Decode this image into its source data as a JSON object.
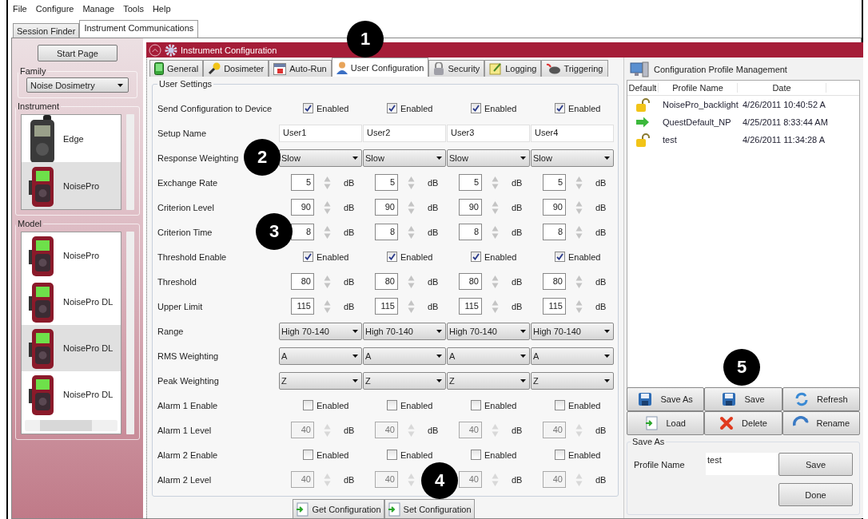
{
  "menu": [
    "File",
    "Configure",
    "Manage",
    "Tools",
    "Help"
  ],
  "tabs": [
    {
      "label": "Session Finder",
      "selected": false
    },
    {
      "label": "Instrument Communications",
      "selected": true
    }
  ],
  "sidebar": {
    "start_button": "Start Page",
    "family": {
      "label": "Family",
      "value": "Noise Dosimetry"
    },
    "instrument": {
      "label": "Instrument",
      "items": [
        {
          "name": "Edge",
          "kind": "edge",
          "selected": false
        },
        {
          "name": "NoisePro",
          "kind": "noisepro",
          "selected": true
        }
      ]
    },
    "model": {
      "label": "Model",
      "items": [
        {
          "name": "NoisePro",
          "kind": "noisepro",
          "selected": false
        },
        {
          "name": "NoisePro DL",
          "kind": "noisepro",
          "selected": false
        },
        {
          "name": "NoisePro DL",
          "kind": "noisepro",
          "selected": true
        },
        {
          "name": "NoisePro DL",
          "kind": "noisepro",
          "selected": false
        }
      ]
    }
  },
  "config": {
    "title": "Instrument Configuration",
    "tabs": [
      {
        "label": "General",
        "selected": false
      },
      {
        "label": "Dosimeter",
        "selected": false
      },
      {
        "label": "Auto-Run",
        "selected": false
      },
      {
        "label": "User Configuration",
        "selected": true
      },
      {
        "label": "Security",
        "selected": false
      },
      {
        "label": "Logging",
        "selected": false
      },
      {
        "label": "Triggering",
        "selected": false
      }
    ],
    "group": "User Settings",
    "rows": [
      {
        "label": "Send Configuration to Device",
        "kind": "check",
        "cells": [
          {
            "label": "Enabled",
            "checked": true
          },
          {
            "label": "Enabled",
            "checked": true
          },
          {
            "label": "Enabled",
            "checked": true
          },
          {
            "label": "Enabled",
            "checked": true
          }
        ]
      },
      {
        "label": "Setup Name",
        "kind": "text",
        "cells": [
          {
            "value": "User1"
          },
          {
            "value": "User2"
          },
          {
            "value": "User3"
          },
          {
            "value": "User4"
          }
        ]
      },
      {
        "label": "Response Weighting",
        "kind": "select",
        "cells": [
          {
            "value": "Slow"
          },
          {
            "value": "Slow"
          },
          {
            "value": "Slow"
          },
          {
            "value": "Slow"
          }
        ]
      },
      {
        "label": "Exchange Rate",
        "kind": "number",
        "cells": [
          {
            "value": "5",
            "unit": "dB",
            "disabled": false
          },
          {
            "value": "5",
            "unit": "dB",
            "disabled": false
          },
          {
            "value": "5",
            "unit": "dB",
            "disabled": false
          },
          {
            "value": "5",
            "unit": "dB",
            "disabled": false
          }
        ]
      },
      {
        "label": "Criterion Level",
        "kind": "number",
        "cells": [
          {
            "value": "90",
            "unit": "dB",
            "disabled": false
          },
          {
            "value": "90",
            "unit": "dB",
            "disabled": false
          },
          {
            "value": "90",
            "unit": "dB",
            "disabled": false
          },
          {
            "value": "90",
            "unit": "dB",
            "disabled": false
          }
        ]
      },
      {
        "label": "Criterion Time",
        "kind": "number",
        "cells": [
          {
            "value": "8",
            "unit": "dB",
            "disabled": false
          },
          {
            "value": "8",
            "unit": "dB",
            "disabled": false
          },
          {
            "value": "8",
            "unit": "dB",
            "disabled": false
          },
          {
            "value": "8",
            "unit": "dB",
            "disabled": false
          }
        ]
      },
      {
        "label": "Threshold Enable",
        "kind": "check",
        "cells": [
          {
            "label": "Enabled",
            "checked": true
          },
          {
            "label": "Enabled",
            "checked": true
          },
          {
            "label": "Enabled",
            "checked": true
          },
          {
            "label": "Enabled",
            "checked": true
          }
        ]
      },
      {
        "label": "Threshold",
        "kind": "number",
        "cells": [
          {
            "value": "80",
            "unit": "dB",
            "disabled": false
          },
          {
            "value": "80",
            "unit": "dB",
            "disabled": false
          },
          {
            "value": "80",
            "unit": "dB",
            "disabled": false
          },
          {
            "value": "80",
            "unit": "dB",
            "disabled": false
          }
        ]
      },
      {
        "label": "Upper Limit",
        "kind": "number",
        "cells": [
          {
            "value": "115",
            "unit": "dB",
            "disabled": false
          },
          {
            "value": "115",
            "unit": "dB",
            "disabled": false
          },
          {
            "value": "115",
            "unit": "dB",
            "disabled": false
          },
          {
            "value": "115",
            "unit": "dB",
            "disabled": false
          }
        ]
      },
      {
        "label": "Range",
        "kind": "select",
        "cells": [
          {
            "value": "High 70-140"
          },
          {
            "value": "High 70-140"
          },
          {
            "value": "High 70-140"
          },
          {
            "value": "High 70-140"
          }
        ]
      },
      {
        "label": "RMS Weighting",
        "kind": "select",
        "cells": [
          {
            "value": "A"
          },
          {
            "value": "A"
          },
          {
            "value": "A"
          },
          {
            "value": "A"
          }
        ]
      },
      {
        "label": "Peak Weighting",
        "kind": "select",
        "cells": [
          {
            "value": "Z"
          },
          {
            "value": "Z"
          },
          {
            "value": "Z"
          },
          {
            "value": "Z"
          }
        ]
      },
      {
        "label": "Alarm 1 Enable",
        "kind": "check",
        "cells": [
          {
            "label": "Enabled",
            "checked": false
          },
          {
            "label": "Enabled",
            "checked": false
          },
          {
            "label": "Enabled",
            "checked": false
          },
          {
            "label": "Enabled",
            "checked": false
          }
        ]
      },
      {
        "label": "Alarm 1 Level",
        "kind": "number",
        "cells": [
          {
            "value": "40",
            "unit": "dB",
            "disabled": true
          },
          {
            "value": "40",
            "unit": "dB",
            "disabled": true
          },
          {
            "value": "40",
            "unit": "dB",
            "disabled": true
          },
          {
            "value": "40",
            "unit": "dB",
            "disabled": true
          }
        ]
      },
      {
        "label": "Alarm 2 Enable",
        "kind": "check",
        "cells": [
          {
            "label": "Enabled",
            "checked": false
          },
          {
            "label": "Enabled",
            "checked": false
          },
          {
            "label": "Enabled",
            "checked": false
          },
          {
            "label": "Enabled",
            "checked": false
          }
        ]
      },
      {
        "label": "Alarm 2 Level",
        "kind": "number",
        "cells": [
          {
            "value": "40",
            "unit": "dB",
            "disabled": true
          },
          {
            "value": "40",
            "disabled": true
          },
          {
            "value": "40",
            "unit": "dB",
            "disabled": true
          },
          {
            "value": "40",
            "unit": "dB",
            "disabled": true
          }
        ]
      }
    ],
    "buttons": [
      "Get Configuration",
      "Set Configuration"
    ]
  },
  "profiles": {
    "title": "Configuration Profile Management",
    "columns": [
      "Default",
      "Profile Name",
      "Date"
    ],
    "rows": [
      {
        "kind": "unlocked",
        "name": "NoisePro_backlight",
        "date": "4/26/2011 10:40:52 A"
      },
      {
        "kind": "default",
        "name": "QuestDefault_NP",
        "date": "4/25/2011 8:33:44 AM"
      },
      {
        "kind": "unlocked",
        "name": "test",
        "date": "4/26/2011 11:34:28 A"
      }
    ],
    "buttons": [
      "Save As",
      "Save",
      "Refresh",
      "Load",
      "Delete",
      "Rename"
    ],
    "save_as": {
      "title": "Save As",
      "label": "Profile Name",
      "value": "test",
      "buttons": [
        "Save",
        "Done"
      ]
    }
  },
  "callouts": [
    "1",
    "2",
    "3",
    "4",
    "5"
  ]
}
